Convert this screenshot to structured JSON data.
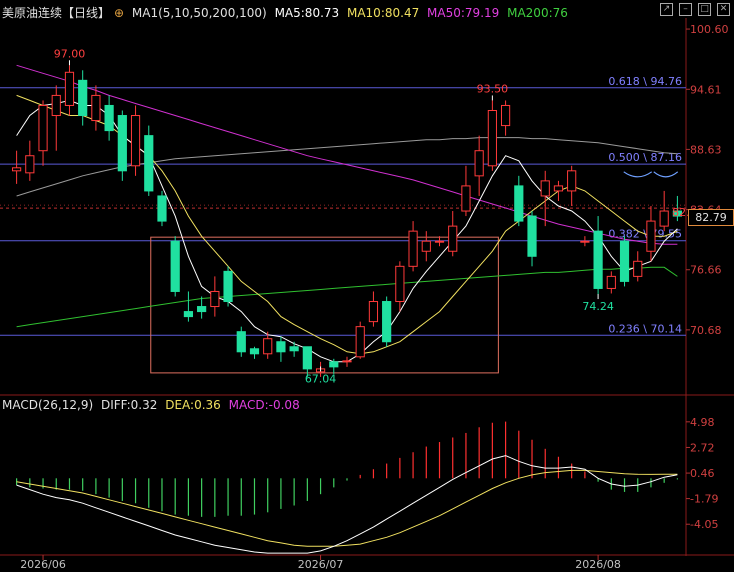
{
  "header": {
    "symbol": "美原油连续",
    "period": "【日线】",
    "ma_params": "MA1(5,10,50,200,100)",
    "ma5": "MA5:80.73",
    "ma10": "MA10:80.47",
    "ma50": "MA50:79.19",
    "ma200": "MA200:76",
    "colors": {
      "ma5": "#ffffff",
      "ma10": "#f0e060",
      "ma50": "#e040e0",
      "ma200": "#40d040"
    }
  },
  "macd_header": {
    "params": "MACD(26,12,9)",
    "diff": "DIFF:0.32",
    "dea": "DEA:0.36",
    "macd": "MACD:-0.08"
  },
  "window_buttons": [
    "arrow-icon",
    "minimize-icon",
    "maximize-icon",
    "close-icon"
  ],
  "last_price": "82.79",
  "chart_data": {
    "type": "candlestick",
    "price_axis": {
      "ticks": [
        "100.60",
        "94.61",
        "88.63",
        "82.64",
        "76.66",
        "70.68"
      ],
      "values": [
        100.6,
        94.61,
        88.63,
        82.64,
        76.66,
        70.68
      ],
      "ylim": [
        64.5,
        101.7
      ]
    },
    "macd_axis": {
      "ticks": [
        "4.98",
        "2.72",
        "0.46",
        "-1.79",
        "-4.05"
      ],
      "values": [
        4.98,
        2.72,
        0.46,
        -1.79,
        -4.05
      ],
      "ylim": [
        -6.5,
        6.2
      ]
    },
    "x_labels": [
      {
        "label": "2026/06",
        "index": 2
      },
      {
        "label": "2026/07",
        "index": 23
      },
      {
        "label": "2026/08",
        "index": 44
      }
    ],
    "fib_levels": [
      {
        "label": "0.618 \\ 94.76",
        "value": 94.76
      },
      {
        "label": "0.500 \\ 87.16",
        "value": 87.16
      },
      {
        "label": "0.382 \\ 79.55",
        "value": 79.55
      },
      {
        "label": "0.236 \\ 70.14",
        "value": 70.14
      }
    ],
    "dashed_level": 82.79,
    "high_label": {
      "text": "97.00",
      "index": 4,
      "value": 97.0
    },
    "high2_label": {
      "text": "93.50",
      "index": 36,
      "value": 93.5
    },
    "low_label": {
      "text": "67.04",
      "index": 23,
      "value": 67.04
    },
    "low2_label": {
      "text": "74.24",
      "index": 44,
      "value": 74.24
    },
    "last_label": {
      "text": "82.40",
      "index": 49,
      "value": 82.4
    },
    "candles": [
      [
        86.5,
        86.8,
        88.5,
        85.2
      ],
      [
        86.3,
        88.0,
        89.5,
        85.5
      ],
      [
        88.5,
        93.0,
        93.5,
        87.0
      ],
      [
        92.0,
        94.0,
        95.0,
        88.5
      ],
      [
        93.0,
        96.3,
        97.0,
        92.0
      ],
      [
        95.5,
        92.0,
        96.5,
        91.0
      ],
      [
        91.5,
        94.0,
        95.0,
        90.5
      ],
      [
        93.0,
        90.5,
        94.0,
        89.5
      ],
      [
        92.0,
        86.5,
        92.5,
        85.5
      ],
      [
        87.0,
        92.0,
        93.0,
        86.0
      ],
      [
        90.0,
        84.5,
        91.0,
        84.0
      ],
      [
        84.0,
        81.5,
        84.5,
        81.0
      ],
      [
        79.5,
        74.5,
        80.0,
        74.0
      ],
      [
        72.5,
        72.0,
        74.5,
        71.5
      ],
      [
        73.0,
        72.5,
        74.0,
        71.8
      ],
      [
        73.0,
        74.5,
        76.0,
        72.0
      ],
      [
        76.5,
        73.5,
        77.0,
        73.0
      ],
      [
        70.5,
        68.5,
        71.0,
        68.0
      ],
      [
        68.8,
        68.3,
        69.0,
        67.8
      ],
      [
        68.3,
        69.8,
        70.5,
        67.8
      ],
      [
        69.5,
        68.5,
        70.0,
        67.5
      ],
      [
        69.0,
        68.6,
        69.5,
        68.0
      ],
      [
        69.0,
        66.8,
        69.0,
        66.0
      ],
      [
        66.5,
        66.8,
        67.5,
        66.0
      ],
      [
        67.5,
        67.0,
        67.8,
        66.3
      ],
      [
        67.6,
        67.6,
        68.0,
        67.0
      ],
      [
        68.0,
        71.0,
        71.5,
        67.8
      ],
      [
        71.5,
        73.5,
        74.5,
        71.0
      ],
      [
        73.5,
        69.5,
        74.0,
        69.0
      ],
      [
        73.5,
        77.0,
        77.5,
        72.5
      ],
      [
        77.0,
        80.5,
        81.5,
        76.5
      ],
      [
        78.5,
        79.5,
        80.5,
        77.5
      ],
      [
        79.5,
        79.5,
        80.0,
        79.0
      ],
      [
        78.5,
        81.0,
        82.5,
        78.0
      ],
      [
        82.5,
        85.0,
        87.0,
        82.0
      ],
      [
        86.0,
        88.5,
        90.0,
        84.0
      ],
      [
        87.0,
        92.5,
        93.5,
        86.5
      ],
      [
        91.0,
        93.0,
        93.5,
        90.0
      ],
      [
        85.0,
        81.5,
        86.0,
        81.0
      ],
      [
        82.0,
        78.0,
        82.5,
        77.0
      ],
      [
        84.0,
        85.5,
        86.5,
        81.0
      ],
      [
        84.5,
        85.0,
        85.5,
        83.5
      ],
      [
        84.5,
        86.5,
        87.0,
        83.0
      ],
      [
        79.5,
        79.5,
        80.0,
        79.0
      ],
      [
        80.5,
        74.8,
        82.0,
        74.2
      ],
      [
        74.8,
        76.0,
        76.5,
        74.3
      ],
      [
        79.5,
        75.5,
        80.0,
        75.0
      ],
      [
        76.0,
        77.5,
        78.5,
        75.5
      ],
      [
        78.5,
        81.5,
        83.0,
        77.5
      ],
      [
        81.0,
        82.5,
        84.5,
        80.5
      ],
      [
        82.5,
        82.0,
        84.0,
        81.5
      ]
    ],
    "macd_hist": [
      -0.6,
      -0.8,
      -0.9,
      -1.0,
      -1.0,
      -1.1,
      -1.4,
      -1.7,
      -2.0,
      -2.2,
      -2.6,
      -2.9,
      -3.2,
      -3.3,
      -3.4,
      -3.4,
      -3.3,
      -3.3,
      -3.2,
      -3.0,
      -2.7,
      -2.4,
      -2.0,
      -1.4,
      -0.8,
      -0.2,
      0.3,
      0.8,
      1.3,
      1.8,
      2.3,
      2.8,
      3.2,
      3.6,
      4.0,
      4.5,
      4.9,
      5.0,
      4.2,
      3.4,
      2.6,
      1.9,
      1.3,
      0.6,
      -0.3,
      -1.0,
      -1.2,
      -1.2,
      -0.8,
      -0.4,
      -0.1
    ],
    "diff": [
      -0.6,
      -1.0,
      -1.4,
      -1.7,
      -1.9,
      -2.2,
      -2.6,
      -3.0,
      -3.4,
      -3.8,
      -4.2,
      -4.6,
      -5.0,
      -5.3,
      -5.6,
      -5.9,
      -6.1,
      -6.3,
      -6.5,
      -6.6,
      -6.6,
      -6.6,
      -6.6,
      -6.4,
      -6.0,
      -5.5,
      -4.9,
      -4.3,
      -3.6,
      -2.9,
      -2.2,
      -1.5,
      -0.8,
      -0.1,
      0.5,
      1.1,
      1.7,
      2.0,
      1.5,
      1.1,
      0.9,
      0.9,
      1.0,
      0.8,
      0.0,
      -0.5,
      -0.7,
      -0.6,
      -0.3,
      0.1,
      0.32
    ],
    "dea": [
      -0.3,
      -0.5,
      -0.7,
      -0.9,
      -1.1,
      -1.3,
      -1.6,
      -1.9,
      -2.2,
      -2.5,
      -2.8,
      -3.1,
      -3.4,
      -3.7,
      -4.0,
      -4.3,
      -4.6,
      -4.9,
      -5.2,
      -5.5,
      -5.7,
      -5.9,
      -6.0,
      -6.0,
      -6.0,
      -5.9,
      -5.8,
      -5.5,
      -5.2,
      -4.8,
      -4.3,
      -3.8,
      -3.3,
      -2.7,
      -2.1,
      -1.5,
      -0.9,
      -0.4,
      0.0,
      0.3,
      0.5,
      0.6,
      0.7,
      0.7,
      0.6,
      0.5,
      0.4,
      0.35,
      0.34,
      0.35,
      0.36
    ],
    "ma5": [
      90,
      92,
      93,
      93.2,
      93.5,
      93,
      93,
      92,
      90,
      89,
      88,
      85,
      82,
      78,
      75,
      74,
      73.5,
      72.5,
      71,
      70.2,
      70,
      69.3,
      68.8,
      68,
      67.5,
      67.5,
      68.3,
      69.5,
      70.5,
      72.5,
      74.8,
      76.5,
      78,
      79.5,
      81,
      83.5,
      86,
      88,
      87.5,
      85.5,
      84,
      83,
      82.5,
      81.5,
      80,
      78,
      76.5,
      77,
      77.5,
      79.5,
      80.73
    ],
    "ma10": [
      94,
      93.5,
      93,
      92.5,
      92,
      92,
      91.5,
      91,
      90,
      89,
      88,
      86.5,
      84.5,
      82,
      80,
      78.5,
      77,
      75.5,
      74.5,
      73.5,
      72,
      71.2,
      70.5,
      69.8,
      69.2,
      68.5,
      68.3,
      68.5,
      69,
      69.5,
      70.5,
      71.5,
      72.5,
      74,
      75.5,
      77,
      78.5,
      80.5,
      81.5,
      82.5,
      83.5,
      84.5,
      85,
      84.5,
      83.5,
      82.5,
      81.5,
      80.5,
      80,
      80,
      80.47
    ],
    "ma50": [
      97,
      96.6,
      96.2,
      95.8,
      95.4,
      94.9,
      94.5,
      94,
      93.6,
      93.2,
      92.8,
      92.4,
      92,
      91.6,
      91.2,
      90.8,
      90.4,
      90,
      89.6,
      89.2,
      88.8,
      88.4,
      88,
      87.7,
      87.4,
      87.1,
      86.8,
      86.5,
      86.2,
      85.9,
      85.6,
      85.2,
      84.8,
      84.4,
      84,
      83.6,
      83.2,
      82.8,
      82.4,
      82,
      81.6,
      81.2,
      80.9,
      80.6,
      80.3,
      80,
      79.7,
      79.5,
      79.3,
      79.2,
      79.19
    ],
    "ma200": [
      84,
      84.4,
      84.8,
      85.2,
      85.6,
      86,
      86.3,
      86.6,
      86.9,
      87.1,
      87.3,
      87.5,
      87.7,
      87.8,
      87.9,
      88,
      88.1,
      88.2,
      88.3,
      88.4,
      88.5,
      88.6,
      88.7,
      88.8,
      88.9,
      89,
      89.1,
      89.2,
      89.3,
      89.4,
      89.5,
      89.6,
      89.6,
      89.7,
      89.7,
      89.8,
      89.8,
      89.8,
      89.8,
      89.7,
      89.7,
      89.6,
      89.5,
      89.4,
      89.3,
      89.1,
      88.9,
      88.7,
      88.5,
      88.3,
      88.2
    ],
    "ma100": [
      71,
      71.2,
      71.4,
      71.6,
      71.8,
      72,
      72.2,
      72.4,
      72.6,
      72.8,
      73,
      73.2,
      73.4,
      73.6,
      73.8,
      73.9,
      74,
      74.1,
      74.2,
      74.3,
      74.4,
      74.5,
      74.6,
      74.7,
      74.8,
      74.9,
      75,
      75.1,
      75.2,
      75.3,
      75.4,
      75.5,
      75.6,
      75.7,
      75.8,
      75.9,
      76,
      76.1,
      76.2,
      76.3,
      76.4,
      76.4,
      76.5,
      76.6,
      76.7,
      76.7,
      76.8,
      76.8,
      76.9,
      76.9,
      76
    ]
  }
}
